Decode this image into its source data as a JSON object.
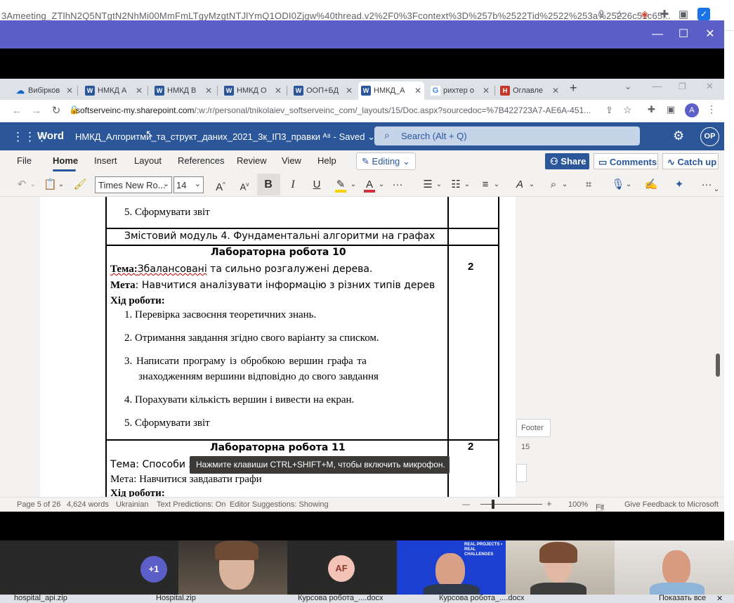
{
  "outer_browser": {
    "url_text": "3Ameeting_ZTlhN2Q5NTgtN2NhMi00MmFmLTgyMzgtNTJlYmQ1ODI0Zjgw%40thread.v2%2F0%3Fcontext%3D%257b%2522Tid%2522%253a%25226c51c65...",
    "icons": [
      "share-icon",
      "star-icon",
      "extension-icon",
      "puzzle-icon",
      "sidebar-icon",
      "checkbox-icon"
    ]
  },
  "teams_window": {
    "minimize": "—",
    "maximize": "☐",
    "close": "✕"
  },
  "tabs": [
    {
      "label": "Вибірков",
      "icon_color": "#0a66c2",
      "icon": "cloud-icon",
      "close": "✕"
    },
    {
      "label": "НМКД А",
      "icon_color": "#2b579a",
      "icon": "word-icon",
      "close": "✕"
    },
    {
      "label": "НМКД В",
      "icon_color": "#2b579a",
      "icon": "word-icon",
      "close": "✕"
    },
    {
      "label": "НМКД О",
      "icon_color": "#2b579a",
      "icon": "word-icon",
      "close": "✕"
    },
    {
      "label": "ООП+БД",
      "icon_color": "#2b579a",
      "icon": "word-icon",
      "close": "✕"
    },
    {
      "label": "НМКД_А",
      "icon_color": "#2b579a",
      "icon": "word-icon",
      "close": "✕"
    },
    {
      "label": "рихтер о",
      "icon_color": "#ffffff",
      "icon": "google-icon",
      "close": "✕"
    },
    {
      "label": "Оглавле",
      "icon_color": "#c0392b",
      "icon": "habr-icon",
      "close": "✕"
    }
  ],
  "new_tab": "+",
  "address": {
    "domain": "softserveinc-my.sharepoint.com",
    "path": "/:w:/r/personal/tnikolaiev_softserveinc_com/_layouts/15/Doc.aspx?sourcedoc=%7B422723A7-AE6A-451...",
    "profile_initial": "A"
  },
  "word": {
    "brand": "Word",
    "doc_title": "НМКД_Алгоритми_та_структ_даних_2021_3к_ІП3_правки",
    "saved": "Saved",
    "search_placeholder": "Search (Alt + Q)",
    "user_initials": "OP"
  },
  "menu": {
    "items": [
      "File",
      "Home",
      "Insert",
      "Layout",
      "References",
      "Review",
      "View",
      "Help"
    ],
    "editing": "Editing",
    "share": "Share",
    "comments": "Comments",
    "catch_up": "Catch up"
  },
  "toolbar": {
    "font_name": "Times New Ro...",
    "font_size": "14",
    "grow_font": "A",
    "shrink_font": "A",
    "bold": "B",
    "italic": "I",
    "underline": "U",
    "highlight_color": "#f5d300",
    "font_color": "#d13438"
  },
  "document": {
    "row1_item": "5.  Сформувати звіт",
    "module_heading": "Змістовий модуль 4. Фундаментальні алгоритми на графах",
    "lab10": {
      "title": "Лабораторна робота 10",
      "topic_label": "Тема:",
      "topic_word1": "Збалансовані",
      "topic_rest": " та сильно розгалужені дерева.",
      "goal_label": "Мета",
      "goal_text": ": Навчитися аналізувати інформацію з різних типів дерев",
      "progress_label": "Хід роботи:",
      "steps": [
        "1.  Перевірка засвоєння теоретичних знань.",
        "2.  Отримання завдання згідно свого варіанту за списком.",
        "3.  Написати   програму   із   обробкою   вершин   графа   та",
        "знаходженням вершини відповідно до свого завдання",
        "4.  Порахувати кількість вершин і вивести на екран.",
        "5.  Сформувати звіт"
      ],
      "hours": "2"
    },
    "lab11": {
      "title": "Лабораторна робота 11",
      "topic": "Тема: Способи за",
      "goal": "Мета: Навчитися завдавати графи",
      "progress": "Хід роботи:",
      "hours": "2"
    }
  },
  "tooltip": "Нажмите клавиши CTRL+SHIFT+M, чтобы включить микрофон.",
  "side": {
    "footer_button": "Footer",
    "page_number": "15"
  },
  "status": {
    "page": "Page 5 of 26",
    "words": "4,624 words",
    "language": "Ukrainian",
    "text_predictions": "Text Predictions: On",
    "editor_suggestions": "Editor Suggestions: Showing",
    "zoom": "100%",
    "fit": "Fit",
    "feedback": "Give Feedback to Microsoft",
    "minus": "—",
    "plus": "+"
  },
  "participants": {
    "more_count": "+1",
    "more_color": "#5b5fc7",
    "af_initials": "AF",
    "af_color": "#f3c3b8",
    "banner_text": "REAL PROJECTS • REAL CHALLENGES"
  },
  "taskbar": {
    "items": [
      "hospital_api.zip",
      "Hospital.zip",
      "Курсова робота_....docx",
      "Курсова робота_....docx"
    ],
    "show_all": "Показать все"
  }
}
